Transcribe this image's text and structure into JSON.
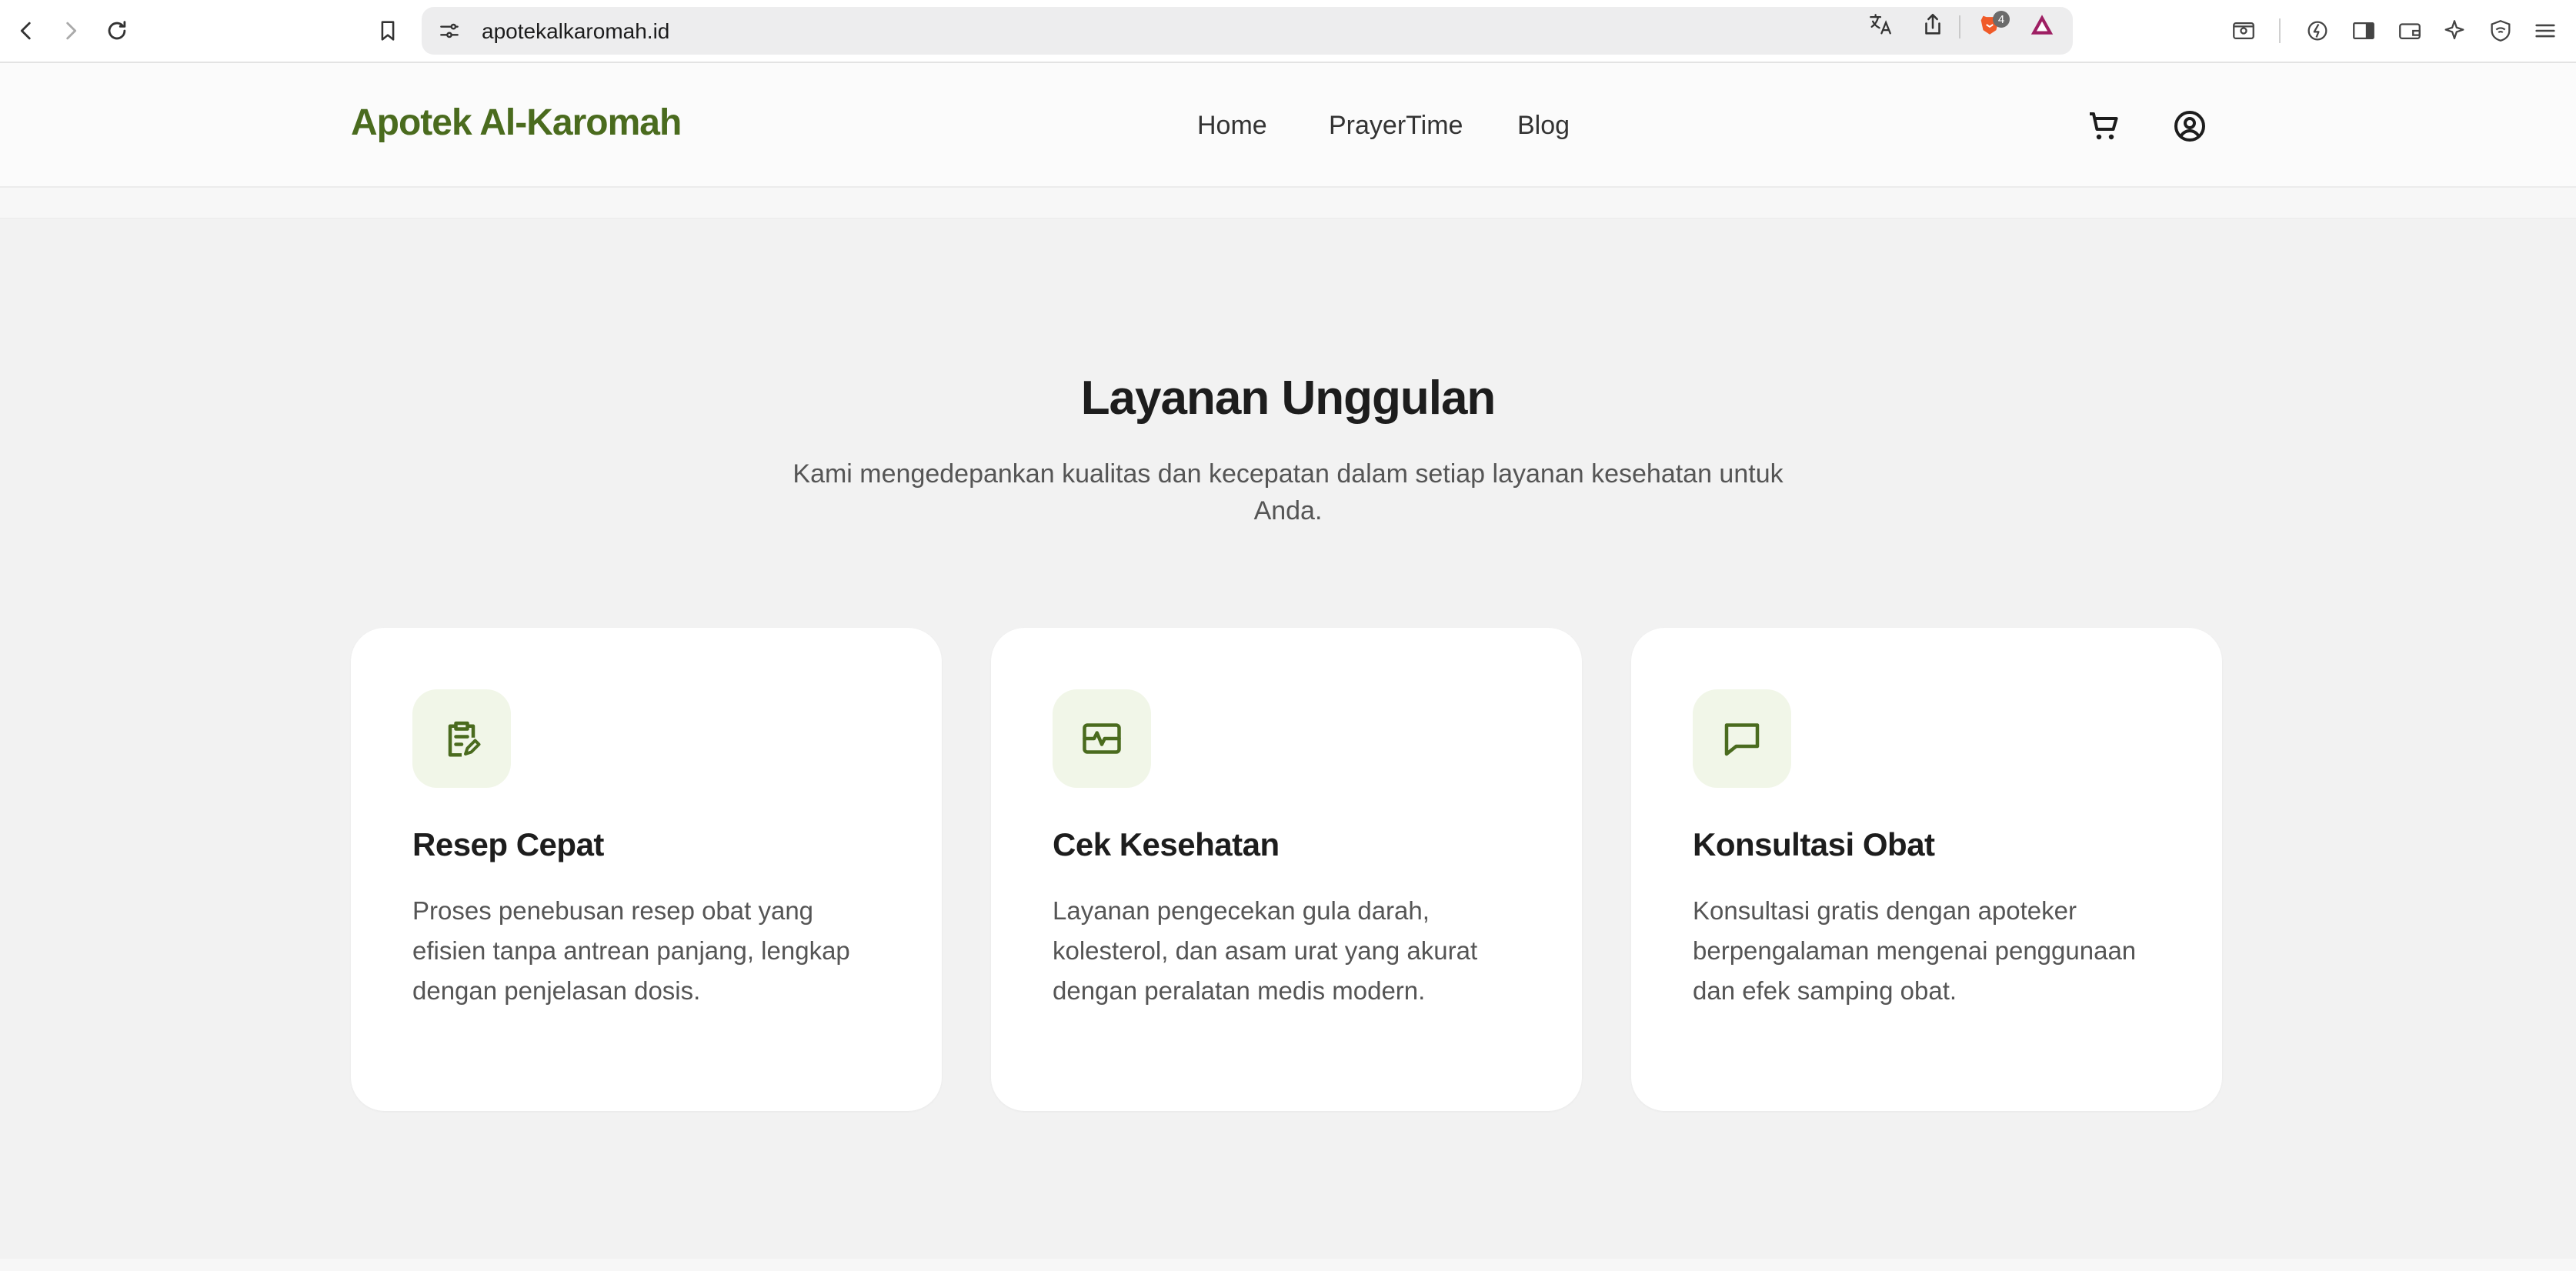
{
  "browser": {
    "url": "apotekalkaromah.id",
    "shields_count": "4"
  },
  "header": {
    "logo": "Apotek Al-Karomah",
    "nav": [
      {
        "label": "Home"
      },
      {
        "label": "PrayerTime"
      },
      {
        "label": "Blog"
      }
    ]
  },
  "section": {
    "title": "Layanan Unggulan",
    "subtitle": "Kami mengedepankan kualitas dan kecepatan dalam setiap layanan kesehatan untuk Anda."
  },
  "cards": [
    {
      "icon": "clipboard-edit-icon",
      "title": "Resep Cepat",
      "text": "Proses penebusan resep obat yang efisien tanpa antrean panjang, lengkap dengan penjelasan dosis."
    },
    {
      "icon": "heart-pulse-monitor-icon",
      "title": "Cek Kesehatan",
      "text": "Layanan pengecekan gula darah, kolesterol, dan asam urat yang akurat dengan peralatan medis modern."
    },
    {
      "icon": "chat-bubble-icon",
      "title": "Konsultasi Obat",
      "text": "Konsultasi gratis dengan apoteker berpengalaman mengenai penggunaan dan efek samping obat."
    }
  ],
  "colors": {
    "brand": "#4a6b1e",
    "icon_bg": "#f1f6e8",
    "page_bg": "#f2f2f2"
  }
}
